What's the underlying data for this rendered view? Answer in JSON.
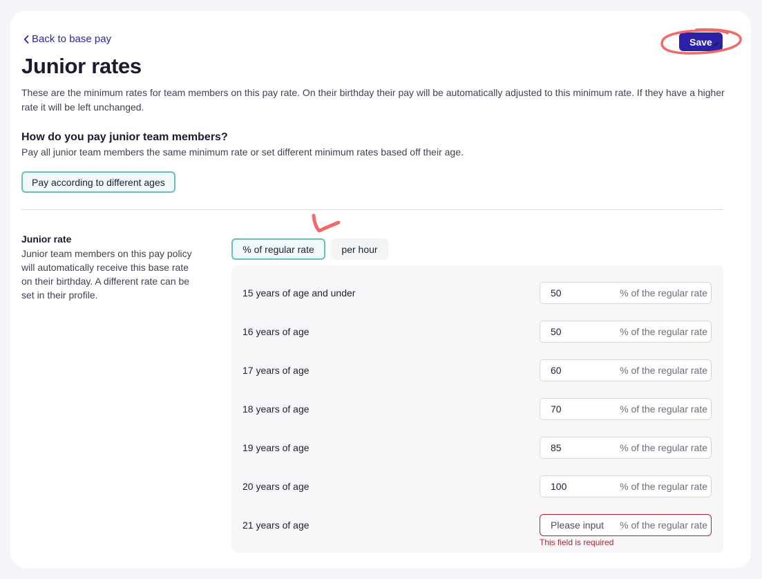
{
  "nav": {
    "back_label": "Back to base pay"
  },
  "toolbar": {
    "save_label": "Save"
  },
  "page": {
    "title": "Junior rates",
    "intro": "These are the minimum rates for team members on this pay rate. On their birthday their pay will be automatically adjusted to this minimum rate. If they have a higher rate it will be left unchanged."
  },
  "pay_method": {
    "heading": "How do you pay junior team members?",
    "description": "Pay all junior team members the same minimum rate or set different minimum rates based off their age.",
    "selected_option": "Pay according to different ages"
  },
  "junior_rate": {
    "title": "Junior rate",
    "description": "Junior team members on this pay policy will automatically receive this base rate on their birthday. A different rate can be set in their profile.",
    "modes": [
      "% of regular rate",
      "per hour"
    ],
    "active_mode": "% of regular rate",
    "suffix": "% of the regular rate",
    "rows": [
      {
        "label": "15 years of age and under",
        "value": "50",
        "placeholder": ""
      },
      {
        "label": "16 years of age",
        "value": "50",
        "placeholder": ""
      },
      {
        "label": "17 years of age",
        "value": "60",
        "placeholder": ""
      },
      {
        "label": "18 years of age",
        "value": "70",
        "placeholder": ""
      },
      {
        "label": "19 years of age",
        "value": "85",
        "placeholder": ""
      },
      {
        "label": "20 years of age",
        "value": "100",
        "placeholder": ""
      },
      {
        "label": "21 years of age",
        "value": "",
        "placeholder": "Please input"
      }
    ],
    "error_message": "This field is required"
  },
  "colors": {
    "accent": "#2b21a8",
    "teal_border": "#66bfbb",
    "error": "#b4232c",
    "annotation": "#f06a6a"
  }
}
